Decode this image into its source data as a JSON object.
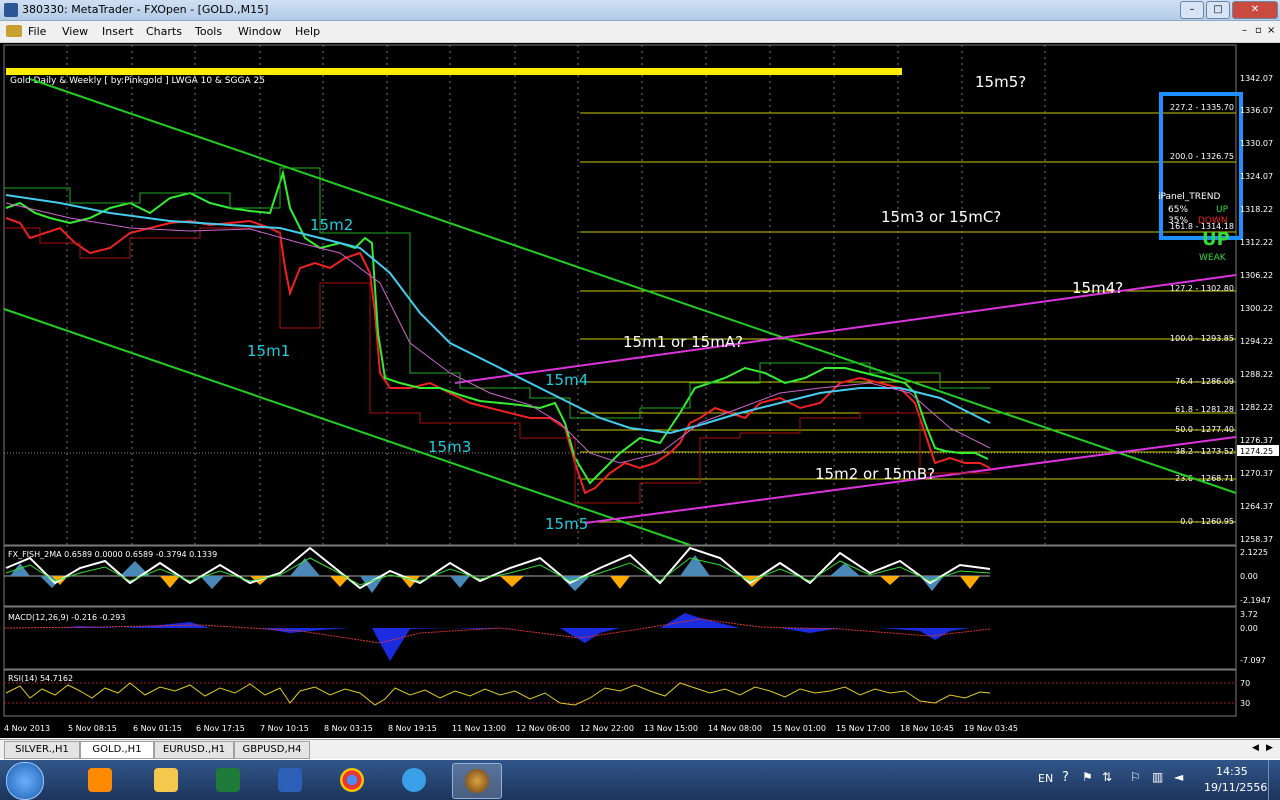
{
  "window": {
    "title": "380330: MetaTrader - FXOpen - [GOLD.,M15]",
    "controls": {
      "minimize": "–",
      "maximize": "□",
      "close": "✕"
    }
  },
  "menu": [
    "File",
    "View",
    "Insert",
    "Charts",
    "Tools",
    "Window",
    "Help"
  ],
  "chart": {
    "header": "Gold Daily & Weekly [ by:Pinkgold ]  LWGA 10 & SGGA 25",
    "price_scale": [
      "1342.07",
      "1336.07",
      "1330.07",
      "1324.07",
      "1318.22",
      "1312.22",
      "1306.22",
      "1300.22",
      "1294.22",
      "1288.22",
      "1282.22",
      "1276.37"
    ],
    "price_scale_low": [
      "1270.37",
      "1264.37",
      "1258.37"
    ],
    "current_price": "1274.25",
    "current_price_alt": "1274.25",
    "fib_levels": [
      {
        "label": "227.2 - 1335.70"
      },
      {
        "label": "200.0 - 1326.75"
      },
      {
        "label": "161.8 - 1314.18"
      },
      {
        "label": "127.2 - 1302.80"
      },
      {
        "label": "100.0 - 1293.85"
      },
      {
        "label": "76.4 - 1286.09"
      },
      {
        "label": "61.8 - 1281.28"
      },
      {
        "label": "50.0 - 1277.40"
      },
      {
        "label": "38.2 - 1273.52"
      },
      {
        "label": "23.6 - 1268.71"
      },
      {
        "label": "0.0 - 1260.95"
      }
    ],
    "annotations": {
      "a1": "15m5?",
      "a2": "15m2",
      "a3": "15m3 or 15mC?",
      "a4": "15m4?",
      "a5": "15m1",
      "a6": "15m1 or 15mA?",
      "a7": "15m4",
      "a8": "15m3",
      "a9": "15m2 or 15mB?",
      "a10": "15m5"
    },
    "ipanel": {
      "title": "iPanel_TREND",
      "up_pct": "65%",
      "up": "UP",
      "down_pct": "35%",
      "down": "DOWN",
      "big": "UP",
      "weak": "WEAK"
    },
    "colors": {
      "bg": "#000000",
      "fib": "#c8c800",
      "trend": "#22cc22",
      "channel": "#dd33dd",
      "label": "#22ccdd",
      "highlight": "#ffee00",
      "frame": "#1e90ff"
    }
  },
  "fisher": {
    "label": "FX_FISH_2MA 0.6589 0.0000 0.6589 -0.3794 0.1339",
    "scale": [
      "2.1225",
      "0.00",
      "-2.1947"
    ]
  },
  "macd": {
    "label": "MACD(12,26,9) -0.216 -0.293",
    "scale": [
      "3.72",
      "0.00",
      "-7.097"
    ]
  },
  "rsi": {
    "label": "RSI(14) 54.7162",
    "scale": [
      "70",
      "30"
    ]
  },
  "time_axis": [
    "4 Nov 2013",
    "5 Nov 08:15",
    "6 Nov 01:15",
    "6 Nov 17:15",
    "7 Nov 10:15",
    "8 Nov 03:15",
    "8 Nov 19:15",
    "11 Nov 13:00",
    "12 Nov 06:00",
    "12 Nov 22:00",
    "13 Nov 15:00",
    "14 Nov 08:00",
    "15 Nov 01:00",
    "15 Nov 17:00",
    "18 Nov 10:45",
    "19 Nov 03:45"
  ],
  "tabs": [
    {
      "label": "SILVER.,H1"
    },
    {
      "label": "GOLD.,H1"
    },
    {
      "label": "EURUSD.,H1"
    },
    {
      "label": "GBPUSD,H4"
    }
  ],
  "taskbar": {
    "lang": "EN",
    "time": "14:35",
    "date": "19/11/2556",
    "icons": [
      "start-orb",
      "media-player-icon",
      "file-explorer-icon",
      "excel-icon",
      "word-icon",
      "chrome-icon",
      "internet-explorer-icon",
      "metatrader-icon"
    ]
  }
}
